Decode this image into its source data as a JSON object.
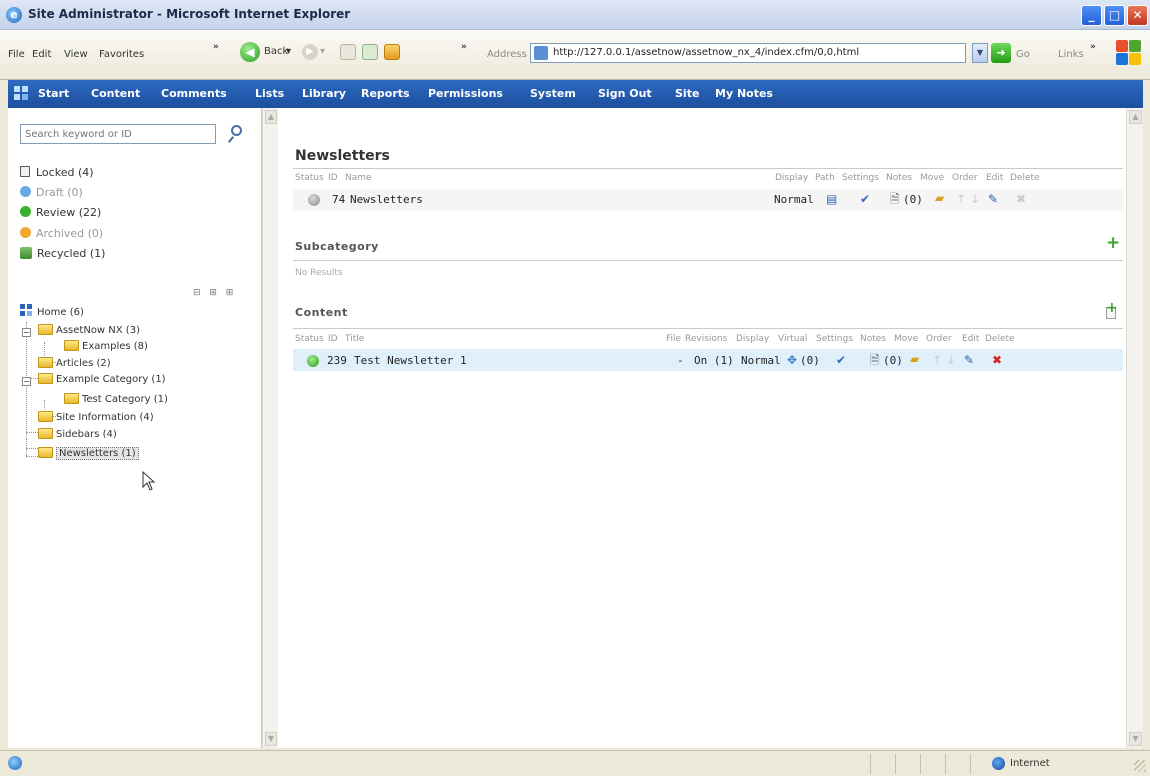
{
  "window": {
    "title": "Site Administrator - Microsoft Internet Explorer"
  },
  "ie_toolbar": {
    "menu": [
      "File",
      "Edit",
      "View",
      "Favorites"
    ],
    "back_label": "Back",
    "address_label": "Address",
    "url": "http://127.0.0.1/assetnow/assetnow_nx_4/index.cfm/0,0,html",
    "go_label": "Go",
    "links_label": "Links"
  },
  "nav": {
    "items": [
      "Start",
      "Content",
      "Comments",
      "Lists",
      "Library",
      "Reports",
      "Permissions",
      "System",
      "Sign Out",
      "Site",
      "My Notes"
    ]
  },
  "sidebar": {
    "search_placeholder": "Search keyword or ID",
    "statuses": [
      {
        "label": "Locked (4)",
        "icon": "lock-icon"
      },
      {
        "label": "Draft (0)",
        "icon": "draft-status-icon",
        "color": "#6aa7e8"
      },
      {
        "label": "Review (22)",
        "icon": "review-status-icon",
        "color": "#3bb02c"
      },
      {
        "label": "Archived (0)",
        "icon": "archived-status-icon",
        "color": "#f0a830"
      },
      {
        "label": "Recycled (1)",
        "icon": "recycle-icon"
      }
    ],
    "tree_controls": "⊟ ⊞ ⊞",
    "tree": {
      "home": "Home (6)",
      "nodes": [
        {
          "label": "AssetNow NX (3)"
        },
        {
          "label": "Examples (8)"
        },
        {
          "label": "Articles (2)"
        },
        {
          "label": "Example Category (1)"
        },
        {
          "label": "Test Category (1)"
        },
        {
          "label": "Site Information (4)"
        },
        {
          "label": "Sidebars (4)"
        },
        {
          "label": "Newsletters (1)"
        }
      ]
    }
  },
  "newsletters": {
    "title": "Newsletters",
    "columns_left": [
      "Status",
      "ID",
      "Name"
    ],
    "columns_right": [
      "Display",
      "Path",
      "Settings",
      "Notes",
      "Move",
      "Order",
      "Edit",
      "Delete"
    ],
    "row": {
      "id": "74",
      "name": "Newsletters",
      "display": "Normal",
      "notes": "(0)",
      "status_color": "#9a9a9a"
    }
  },
  "subcategory": {
    "title": "Subcategory",
    "empty": "No Results"
  },
  "content": {
    "title": "Content",
    "columns_left": [
      "Status",
      "ID",
      "Title"
    ],
    "columns_right": [
      "File",
      "Revisions",
      "Display",
      "Virtual",
      "Settings",
      "Notes",
      "Move",
      "Order",
      "Edit",
      "Delete"
    ],
    "row": {
      "id": "239",
      "title": "Test Newsletter 1",
      "file": "-",
      "revisions": "On (1)",
      "display": "Normal",
      "virtual": "(0)",
      "notes": "(0)",
      "status_color": "#3bb02c"
    }
  },
  "statusbar": {
    "zone": "Internet"
  },
  "colors": {
    "nav_bg": "#1c4f9e",
    "row_highlight": "#dff0fb",
    "delete_red": "#d9261c"
  }
}
